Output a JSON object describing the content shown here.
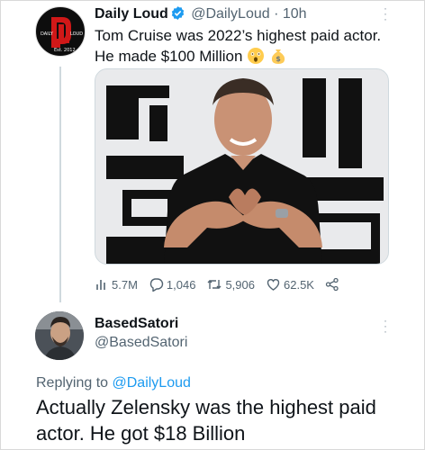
{
  "tweet": {
    "author_name": "Daily Loud",
    "handle": "@DailyLoud",
    "separator": "·",
    "time": "10h",
    "text": "Tom Cruise was 2022’s highest paid actor. He made $100 Million",
    "emojis": [
      "astonished-face",
      "money-bag"
    ],
    "avatar_logo": {
      "top": "DAILY",
      "top_right": "LOUD",
      "bottom": "Est. 2012"
    },
    "verified": true,
    "metrics": {
      "views": "5.7M",
      "replies": "1,046",
      "retweets": "5,906",
      "likes": "62.5K"
    }
  },
  "reply": {
    "author_name": "BasedSatori",
    "handle": "@BasedSatori",
    "replying_label": "Replying to",
    "replying_handle": "@DailyLoud",
    "text": "Actually Zelensky was the highest paid actor. He got $18 Billion"
  },
  "colors": {
    "link": "#1d9bf0",
    "verified": "#1d9bf0",
    "secondary_text": "#536471",
    "thread_line": "#cfd9de"
  }
}
